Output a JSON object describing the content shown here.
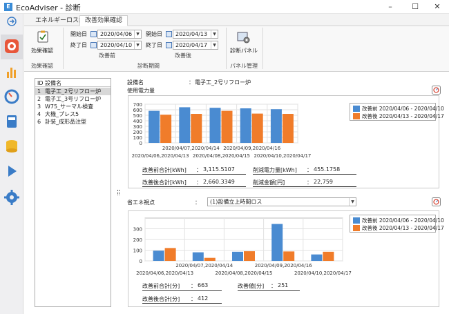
{
  "window": {
    "title": "EcoAdviser - 診断"
  },
  "tabs": [
    {
      "label": "エネルギーロス診断"
    },
    {
      "label": "改善効果確認"
    }
  ],
  "ribbon": {
    "effect_button": "効果確認",
    "effect_group": "効果確認",
    "start_label": "開始日",
    "end_label": "終了日",
    "before": {
      "start": "2020/04/06",
      "end": "2020/04/10",
      "label": "改善前"
    },
    "after": {
      "start": "2020/04/13",
      "end": "2020/04/17",
      "label": "改善後"
    },
    "period_group": "診断期間",
    "panel_button": "診断パネル",
    "panel_group": "パネル管理"
  },
  "equipment_list": {
    "headers": {
      "id": "ID",
      "name": "設備名"
    },
    "rows": [
      {
        "id": "1",
        "name": "電子工_2号リフロー炉"
      },
      {
        "id": "2",
        "name": "電子工_3号リフロー炉"
      },
      {
        "id": "3",
        "name": "W75_サーマル検査"
      },
      {
        "id": "4",
        "name": "大機_プレス5"
      },
      {
        "id": "6",
        "name": "計装_成形品注型"
      }
    ]
  },
  "main": {
    "equipment_label": "設備名",
    "equipment_colon": "：",
    "equipment_value": "電子工_2号リフロー炉",
    "usage_label": "使用電力量",
    "summary1": {
      "before_total_label": "改善前合計[kWh]",
      "before_total": "3,115.5107",
      "after_total_label": "改善後合計[kWh]",
      "after_total": "2,660.3349",
      "reduction_label": "削減電力量[kWh]",
      "reduction": "455.1758",
      "amount_label": "削減金額[円]",
      "amount": "22,759",
      "colon": "："
    },
    "viewpoint_label": "省エネ視点",
    "viewpoint_colon": "：",
    "viewpoint_value": "(1)設備立上時間ロス",
    "summary2": {
      "before_total_label": "改善前合計[分]",
      "before_total": "663",
      "after_total_label": "改善後合計[分]",
      "after_total": "412",
      "improve_label": "改善値[分]",
      "improve": "251",
      "colon": "："
    }
  },
  "colors": {
    "before": "#4a8bd1",
    "after": "#f07c2a"
  },
  "chart_data": [
    {
      "type": "bar",
      "categories": [
        "2020/04/06,2020/04/13",
        "2020/04/07,2020/04/14",
        "2020/04/08,2020/04/15",
        "2020/04/09,2020/04/16",
        "2020/04/10,2020/04/17"
      ],
      "series": [
        {
          "name": "改善前 2020/04/06 - 2020/04/10",
          "values": [
            580,
            645,
            635,
            625,
            610
          ]
        },
        {
          "name": "改善後 2020/04/13 - 2020/04/17",
          "values": [
            510,
            525,
            580,
            530,
            525
          ]
        }
      ],
      "yticks": [
        "0",
        "100",
        "200",
        "300",
        "400",
        "500",
        "600",
        "700"
      ],
      "ylim": [
        0,
        700
      ],
      "legend": "right",
      "grid": true
    },
    {
      "type": "bar",
      "categories": [
        "2020/04/06,2020/04/13",
        "2020/04/07,2020/04/14",
        "2020/04/08,2020/04/15",
        "2020/04/09,2020/04/16",
        "2020/04/10,2020/04/17"
      ],
      "series": [
        {
          "name": "改善前 2020/04/06 - 2020/04/10",
          "values": [
            95,
            80,
            85,
            345,
            60
          ]
        },
        {
          "name": "改善後 2020/04/13 - 2020/04/17",
          "values": [
            120,
            28,
            90,
            88,
            85
          ]
        }
      ],
      "yticks": [
        "0",
        "100",
        "200",
        "300"
      ],
      "ylim": [
        0,
        400
      ],
      "legend": "right",
      "grid": true
    }
  ]
}
